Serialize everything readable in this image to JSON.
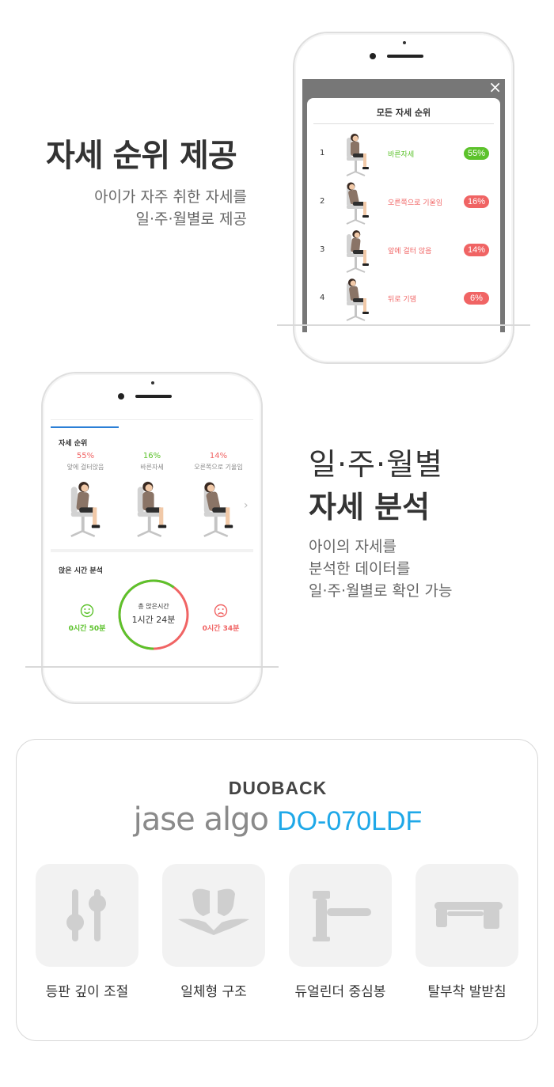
{
  "section1": {
    "title": "자세 순위 제공",
    "desc_line1": "아이가 자주 취한 자세를",
    "desc_line2": "일·주·월별로 제공",
    "popup": {
      "title": "모든 자세 순위",
      "close": "×",
      "rows": [
        {
          "rank": "1",
          "label": "바른자세",
          "percent": "55%",
          "color": "#5cc22b"
        },
        {
          "rank": "2",
          "label": "오른쪽으로 기울임",
          "percent": "16%",
          "color": "#f06464"
        },
        {
          "rank": "3",
          "label": "앞에 걸터 앉음",
          "percent": "14%",
          "color": "#f06464"
        },
        {
          "rank": "4",
          "label": "뒤로 기댐",
          "percent": "6%",
          "color": "#f06464"
        }
      ]
    }
  },
  "section2": {
    "title_line1": "일·주·월별",
    "title_line2": "자세 분석",
    "desc_line1": "아이의 자세를",
    "desc_line2": "분석한 데이터를",
    "desc_line3": "일·주·월별로 확인 가능",
    "app": {
      "rank_heading": "자세 순위",
      "postures": [
        {
          "percent": "55%",
          "label": "앞에 걸터앉음",
          "color": "#f06464"
        },
        {
          "percent": "16%",
          "label": "바른자세",
          "color": "#5cc22b"
        },
        {
          "percent": "14%",
          "label": "오른쪽으로 기울임",
          "color": "#f06464"
        }
      ],
      "sit_heading": "앉은 시간 분석",
      "good_time": "0시간 50분",
      "total_label": "총 앉은시간",
      "total_time": "1시간 24분",
      "bad_time": "0시간 34분",
      "good_fraction": 0.6,
      "colors": {
        "good": "#5cc22b",
        "bad": "#f06464",
        "accent": "#2b7fd6"
      }
    }
  },
  "product": {
    "brand": "DUOBACK",
    "logo_text": "jase algo",
    "model": "DO-070LDF",
    "model_color": "#1ea8e8",
    "features": [
      {
        "icon": "slider-adjust-icon",
        "label": "등판 깊이 조절"
      },
      {
        "icon": "backrest-icon",
        "label": "일체형 구조"
      },
      {
        "icon": "cylinder-icon",
        "label": "듀얼린더 중심봉"
      },
      {
        "icon": "footrest-icon",
        "label": "탈부착 발받침"
      }
    ]
  }
}
